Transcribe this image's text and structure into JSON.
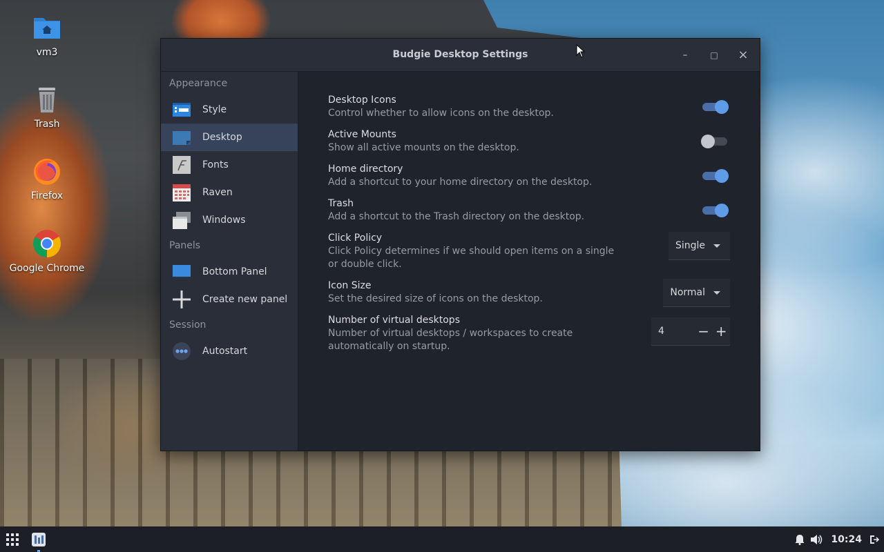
{
  "desktop": {
    "icons": [
      {
        "label": "vm3",
        "icon": "home-folder-icon"
      },
      {
        "label": "Trash",
        "icon": "trash-icon"
      },
      {
        "label": "Firefox",
        "icon": "firefox-icon"
      },
      {
        "label": "Google Chrome",
        "icon": "chrome-icon"
      }
    ]
  },
  "window": {
    "title": "Budgie Desktop Settings",
    "minimize_glyph": "–",
    "maximize_glyph": "□",
    "close_glyph": "×"
  },
  "sidebar": {
    "sections": [
      {
        "header": "Appearance",
        "items": [
          "Style",
          "Desktop",
          "Fonts",
          "Raven",
          "Windows"
        ]
      },
      {
        "header": "Panels",
        "items": [
          "Bottom Panel",
          "Create new panel"
        ]
      },
      {
        "header": "Session",
        "items": [
          "Autostart"
        ]
      }
    ],
    "active_item": "Desktop"
  },
  "settings": {
    "desktop_icons": {
      "title": "Desktop Icons",
      "desc": "Control whether to allow icons on the desktop.",
      "enabled": true
    },
    "active_mounts": {
      "title": "Active Mounts",
      "desc": "Show all active mounts on the desktop.",
      "enabled": false
    },
    "home_directory": {
      "title": "Home directory",
      "desc": "Add a shortcut to your home directory on the desktop.",
      "enabled": true
    },
    "trash": {
      "title": "Trash",
      "desc": "Add a shortcut to the Trash directory on the desktop.",
      "enabled": true
    },
    "click_policy": {
      "title": "Click Policy",
      "desc": "Click Policy determines if we should open items on a single or double click.",
      "value": "Single"
    },
    "icon_size": {
      "title": "Icon Size",
      "desc": "Set the desired size of icons on the desktop.",
      "value": "Normal"
    },
    "virtual_desktops": {
      "title": "Number of virtual desktops",
      "desc": "Number of virtual desktops / workspaces to create automatically on startup.",
      "value": "4",
      "minus": "−",
      "plus": "+"
    }
  },
  "taskbar": {
    "clock": "10:24"
  },
  "colors": {
    "accent": "#5f9ce8",
    "window_bg": "#1f232c",
    "sidebar_bg": "#2a2e38",
    "active_row": "#36435a"
  }
}
